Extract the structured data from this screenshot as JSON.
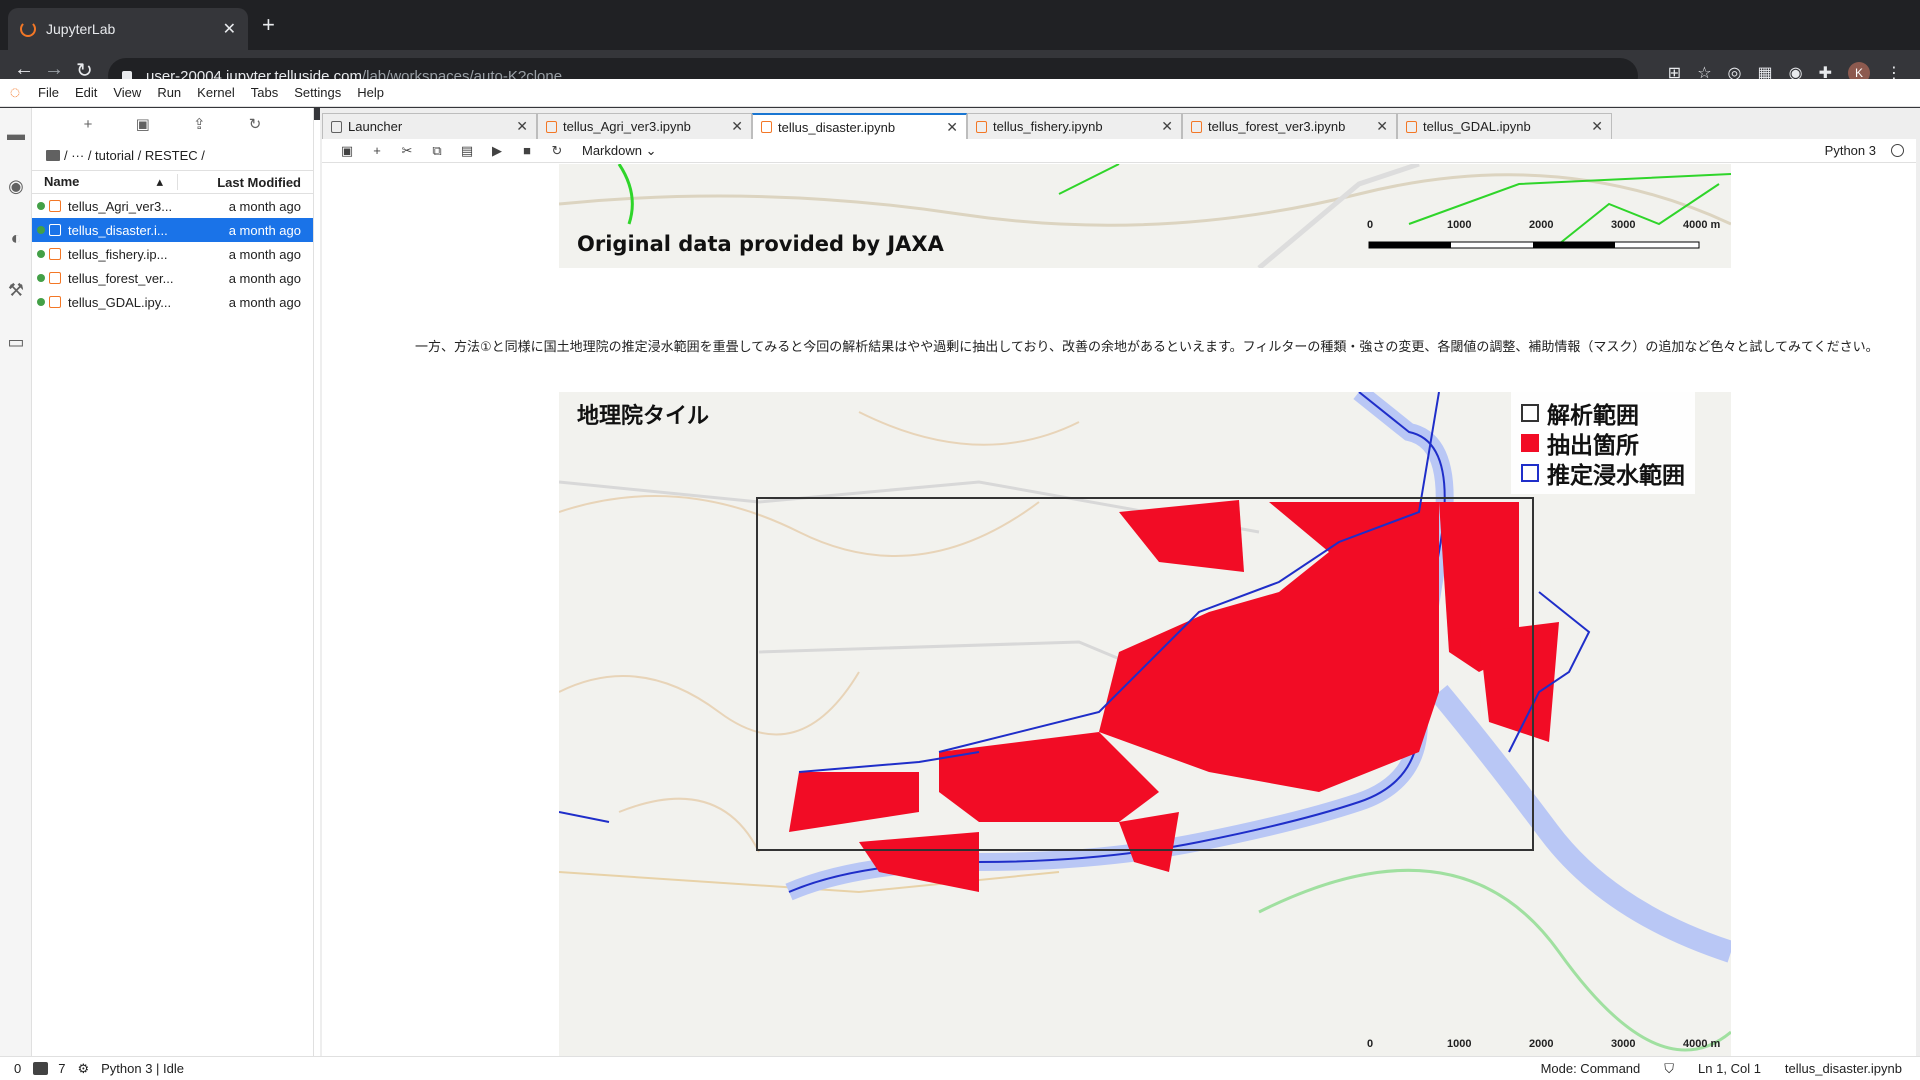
{
  "browser": {
    "tab_title": "JupyterLab",
    "url_host": "user-20004.jupyter.telluside.com",
    "url_path": "/lab/workspaces/auto-K?clone",
    "avatar_letter": "K"
  },
  "menu": [
    "File",
    "Edit",
    "View",
    "Run",
    "Kernel",
    "Tabs",
    "Settings",
    "Help"
  ],
  "filebrowser": {
    "breadcrumb": "/ ··· / tutorial / RESTEC /",
    "col_name": "Name",
    "col_modified": "Last Modified",
    "files": [
      {
        "name": "tellus_Agri_ver3...",
        "modified": "a month ago"
      },
      {
        "name": "tellus_disaster.i...",
        "modified": "a month ago"
      },
      {
        "name": "tellus_fishery.ip...",
        "modified": "a month ago"
      },
      {
        "name": "tellus_forest_ver...",
        "modified": "a month ago"
      },
      {
        "name": "tellus_GDAL.ipy...",
        "modified": "a month ago"
      }
    ]
  },
  "doc_tabs": [
    "Launcher",
    "tellus_Agri_ver3.ipynb",
    "tellus_disaster.ipynb",
    "tellus_fishery.ipynb",
    "tellus_forest_ver3.ipynb",
    "tellus_GDAL.ipynb"
  ],
  "notebook": {
    "cell_type": "Markdown",
    "kernel": "Python 3",
    "top_caption": "Original data provided by JAXA",
    "scale": [
      "0",
      "1000",
      "2000",
      "3000",
      "4000 m"
    ],
    "markdown_text": "一方、方法①と同様に国土地理院の推定浸水範囲を重畳してみると今回の解析結果はやや過剰に抽出しており、改善の余地があるといえます。フィルターの種類・強さの変更、各閾値の調整、補助情報（マスク）の追加など色々と試してみてください。",
    "map_title": "地理院タイル",
    "legend": [
      "解析範囲",
      "抽出箇所",
      "推定浸水範囲"
    ]
  },
  "status": {
    "terminals": "0",
    "kernels": "7",
    "kernel_state": "Python 3 | Idle",
    "mode": "Mode: Command",
    "position": "Ln 1, Col 1",
    "filename": "tellus_disaster.ipynb"
  }
}
